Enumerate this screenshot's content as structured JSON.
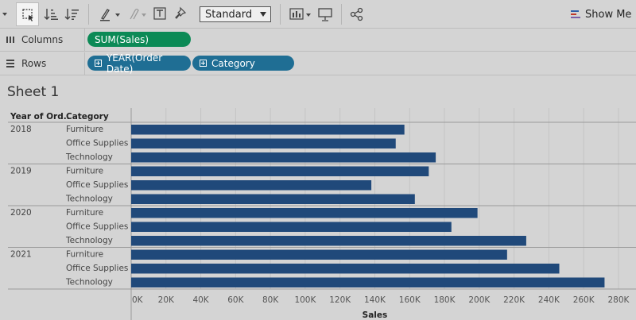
{
  "toolbar": {
    "mark_type_label": "Standard",
    "show_me_label": "Show Me",
    "icons": [
      "dropdown-arrow-icon",
      "select-icon",
      "sort-ascending-icon",
      "sort-descending-icon",
      "highlight-icon",
      "group-icon",
      "label-icon",
      "pin-icon",
      "fit-icon",
      "presentation-icon",
      "share-icon",
      "show-me-icon"
    ]
  },
  "shelves": {
    "columns_label": "Columns",
    "rows_label": "Rows",
    "columns_pills": [
      "SUM(Sales)"
    ],
    "rows_pills": [
      "YEAR(Order Date)",
      "Category"
    ]
  },
  "sheet": {
    "title": "Sheet 1",
    "year_header": "Year of Ord..",
    "category_header": "Category"
  },
  "colors": {
    "bar": "#20497a",
    "measure_pill": "#0c8a56",
    "dimension_pill": "#1f6e94"
  },
  "chart_data": {
    "type": "bar",
    "orientation": "horizontal",
    "xlabel": "Sales",
    "xlim": [
      0,
      290000
    ],
    "xticks": [
      0,
      20000,
      40000,
      60000,
      80000,
      100000,
      120000,
      140000,
      160000,
      180000,
      200000,
      220000,
      240000,
      260000,
      280000
    ],
    "xtick_labels": [
      "0K",
      "20K",
      "40K",
      "60K",
      "80K",
      "100K",
      "120K",
      "140K",
      "160K",
      "180K",
      "200K",
      "220K",
      "240K",
      "260K",
      "280K"
    ],
    "grid": true,
    "groups": [
      {
        "year": "2018",
        "rows": [
          {
            "category": "Furniture",
            "value": 157000
          },
          {
            "category": "Office Supplies",
            "value": 152000
          },
          {
            "category": "Technology",
            "value": 175000
          }
        ]
      },
      {
        "year": "2019",
        "rows": [
          {
            "category": "Furniture",
            "value": 171000
          },
          {
            "category": "Office Supplies",
            "value": 138000
          },
          {
            "category": "Technology",
            "value": 163000
          }
        ]
      },
      {
        "year": "2020",
        "rows": [
          {
            "category": "Furniture",
            "value": 199000
          },
          {
            "category": "Office Supplies",
            "value": 184000
          },
          {
            "category": "Technology",
            "value": 227000
          }
        ]
      },
      {
        "year": "2021",
        "rows": [
          {
            "category": "Furniture",
            "value": 216000
          },
          {
            "category": "Office Supplies",
            "value": 246000
          },
          {
            "category": "Technology",
            "value": 272000
          }
        ]
      }
    ]
  }
}
